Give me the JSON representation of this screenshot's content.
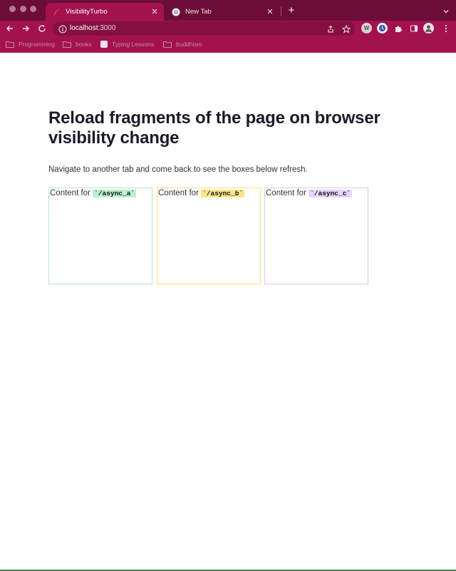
{
  "browser": {
    "tabs": [
      {
        "title": "VisibilityTurbo",
        "active": true
      },
      {
        "title": "New Tab",
        "active": false
      }
    ],
    "url": {
      "host": "localhost",
      "port": ":3000"
    },
    "bookmarks": [
      {
        "label": "Programming",
        "icon": "folder-icon"
      },
      {
        "label": "books",
        "icon": "folder-icon"
      },
      {
        "label": "Typing Lessons",
        "icon": "site-favicon"
      },
      {
        "label": "buddhism",
        "icon": "folder-icon"
      }
    ],
    "extensions": [
      "w-extension-icon",
      "timer-extension-icon",
      "puzzle-icon",
      "sidebar-icon",
      "profile-avatar"
    ],
    "colors": {
      "frame": "#6b0d37",
      "toolbar": "#a3124f",
      "omnibox": "#841040"
    }
  },
  "page": {
    "heading": "Reload fragments of the page on browser visibility change",
    "lede": "Navigate to another tab and come back to see the boxes below refresh.",
    "boxes": [
      {
        "label": "Content for ",
        "code": "`/async_a`",
        "color": "#bbf0cf"
      },
      {
        "label": "Content for ",
        "code": "`/async_b`",
        "color": "#fde68a"
      },
      {
        "label": "Content for ",
        "code": "`/async_c`",
        "color": "#e6d6fb"
      }
    ]
  }
}
